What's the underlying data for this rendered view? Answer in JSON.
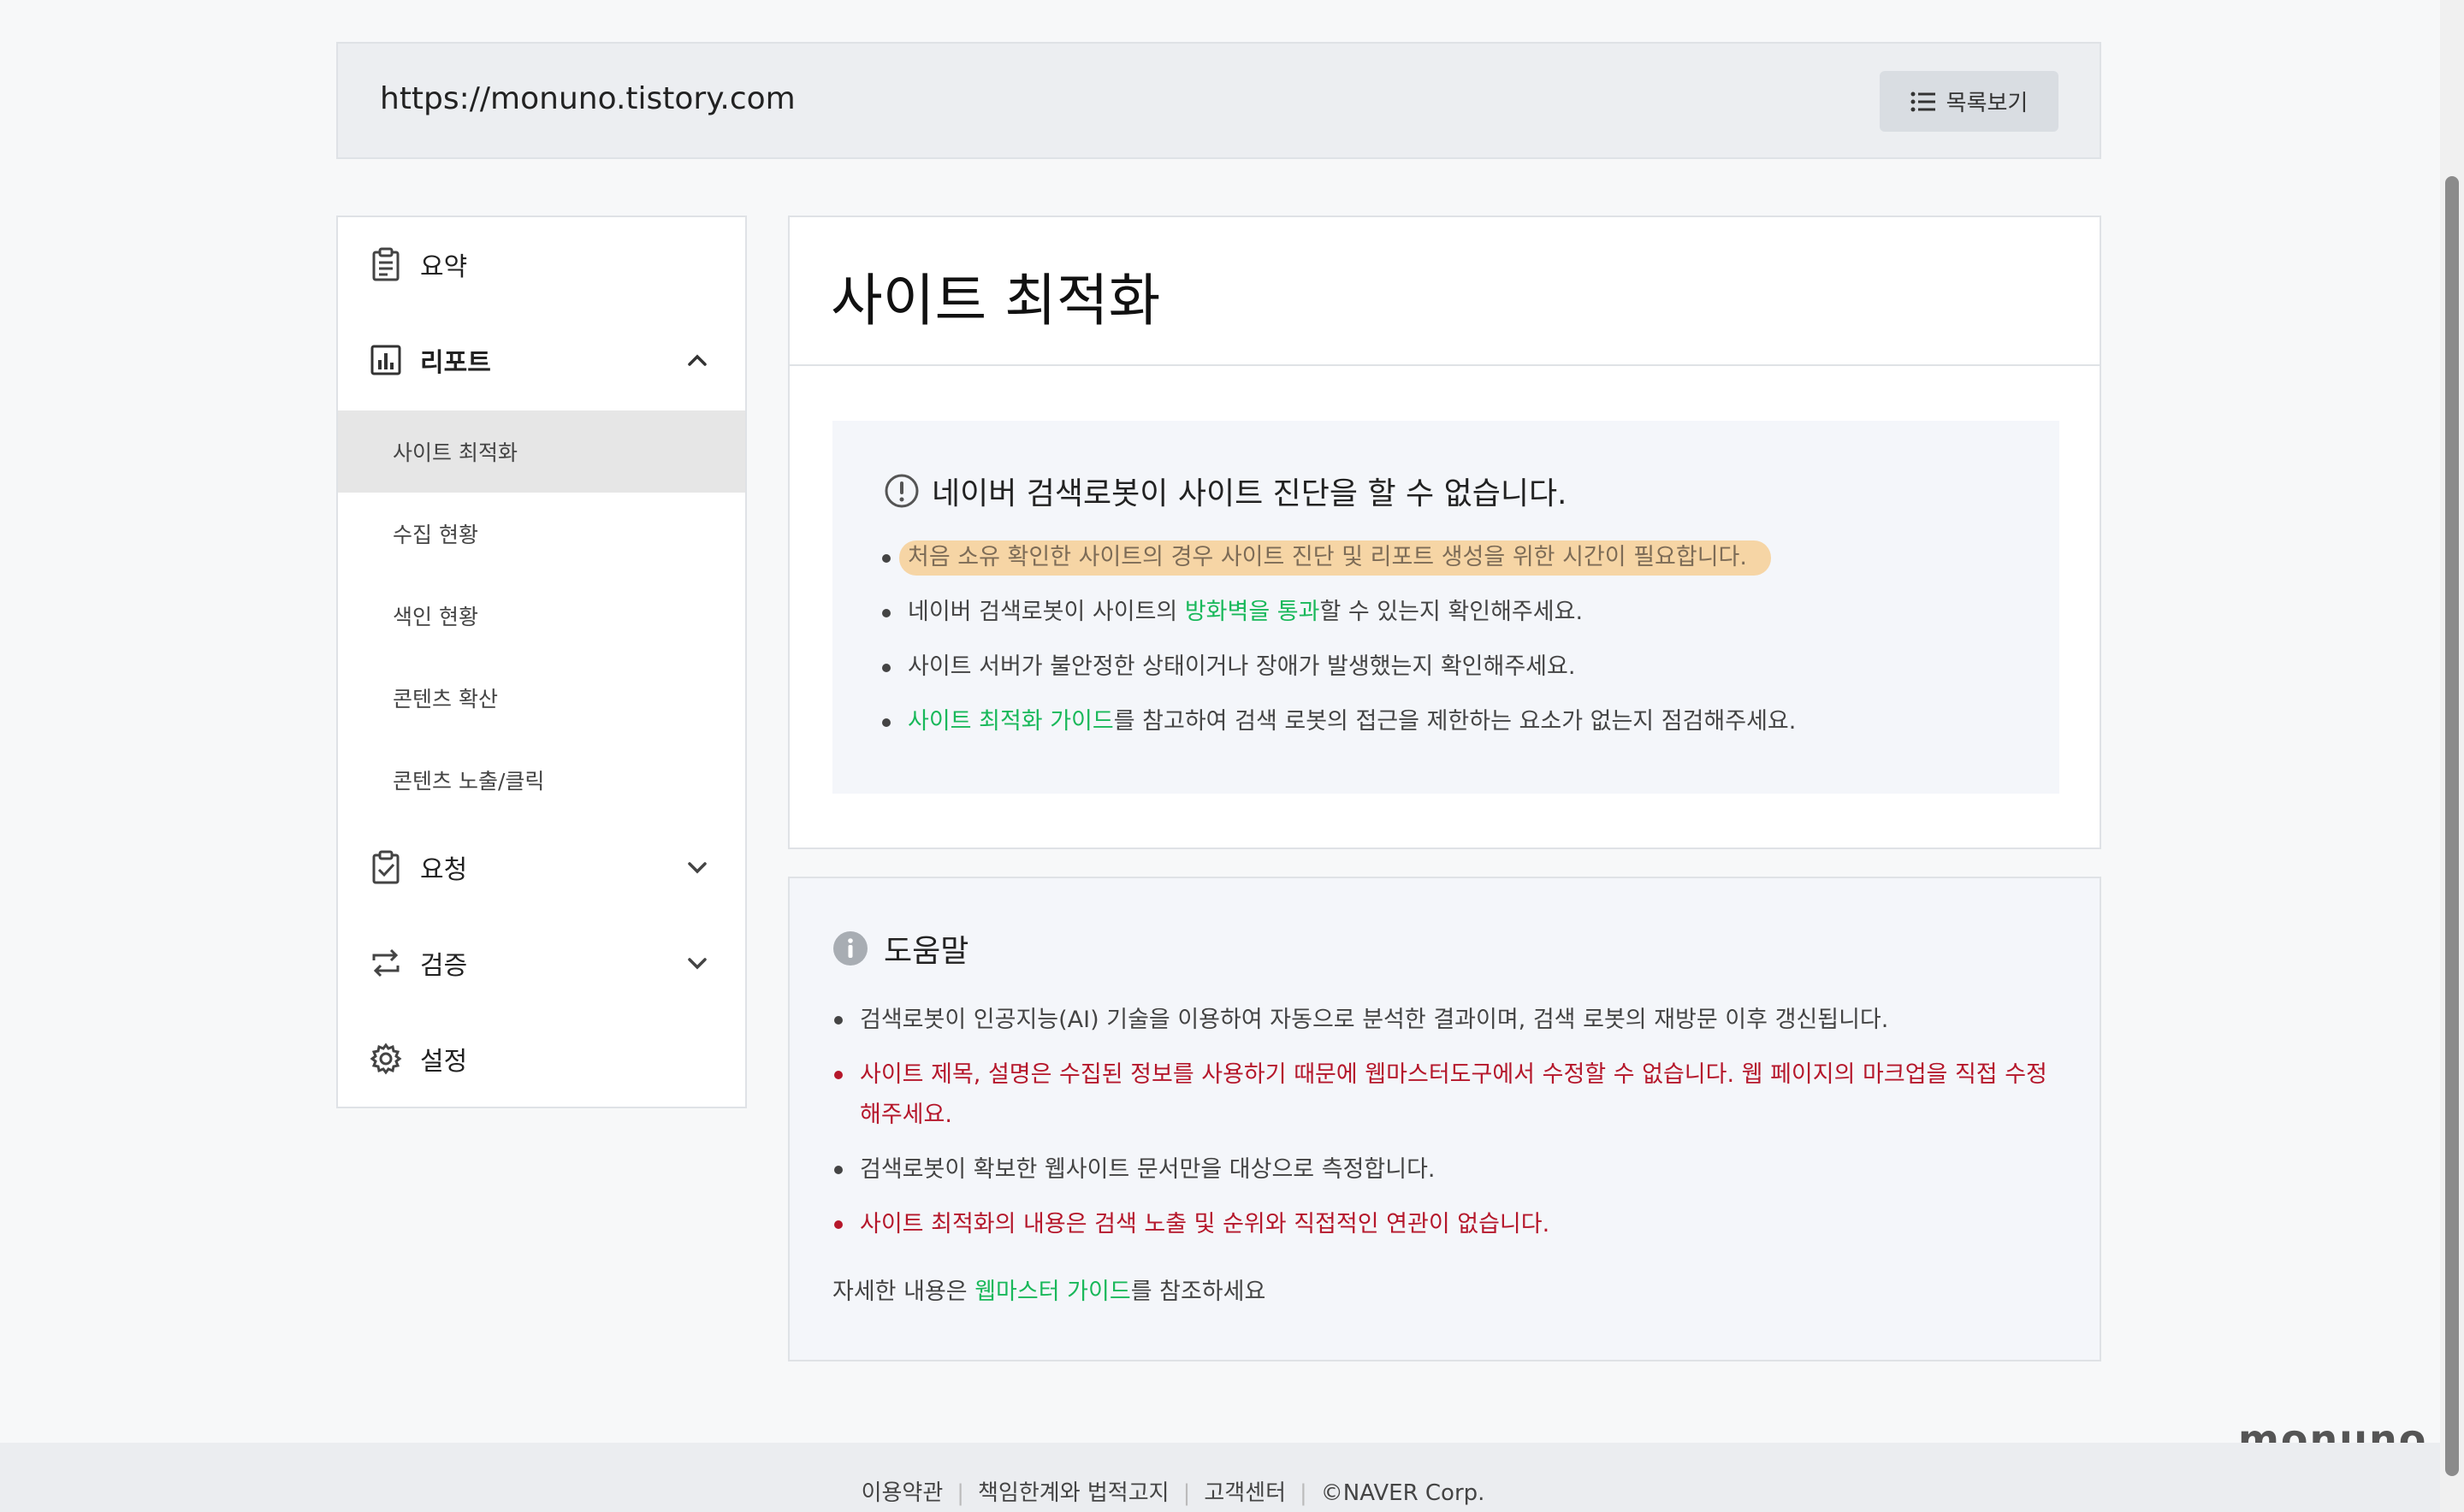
{
  "address": {
    "url": "https://monuno.tistory.com",
    "list_button": "목록보기"
  },
  "sidebar": {
    "summary": "요약",
    "report": "리포트",
    "sub_items": [
      "사이트 최적화",
      "수집 현황",
      "색인 현황",
      "콘텐츠 확산",
      "콘텐츠 노출/클릭"
    ],
    "request": "요청",
    "verify": "검증",
    "settings": "설정"
  },
  "main": {
    "title": "사이트 최적화",
    "notice": {
      "heading": "네이버 검색로봇이 사이트 진단을 할 수 없습니다.",
      "b1": "처음 소유 확인한 사이트의 경우 사이트 진단 및 리포트 생성을 위한 시간이 필요합니다.",
      "b2_pre": "네이버 검색로봇이 사이트의 ",
      "b2_link": "방화벽을 통과",
      "b2_post": "할 수 있는지 확인해주세요.",
      "b3": "사이트 서버가 불안정한 상태이거나 장애가 발생했는지 확인해주세요.",
      "b4_link": "사이트 최적화 가이드",
      "b4_post": "를 참고하여 검색 로봇의 접근을 제한하는 요소가 없는지 점검해주세요."
    }
  },
  "help": {
    "heading": "도움말",
    "items": [
      "검색로봇이 인공지능(AI) 기술을 이용하여 자동으로 분석한 결과이며, 검색 로봇의 재방문 이후 갱신됩니다.",
      "사이트 제목, 설명은 수집된 정보를 사용하기 때문에 웹마스터도구에서 수정할 수 없습니다. 웹 페이지의 마크업을 직접 수정해주세요.",
      "검색로봇이 확보한 웹사이트 문서만을 대상으로 측정합니다.",
      "사이트 최적화의 내용은 검색 노출 및 순위와 직접적인 연관이 없습니다."
    ],
    "more_pre": "자세한 내용은 ",
    "more_link": "웹마스터 가이드",
    "more_post": "를 참조하세요"
  },
  "footer": {
    "terms": "이용약관",
    "disclaimer": "책임한계와 법적고지",
    "support": "고객센터",
    "copyright": "©NAVER Corp."
  },
  "brand": "monuno",
  "colors": {
    "accent_green": "#19b85a",
    "warning_red": "#b5172b",
    "highlight": "#f6d5a5"
  }
}
